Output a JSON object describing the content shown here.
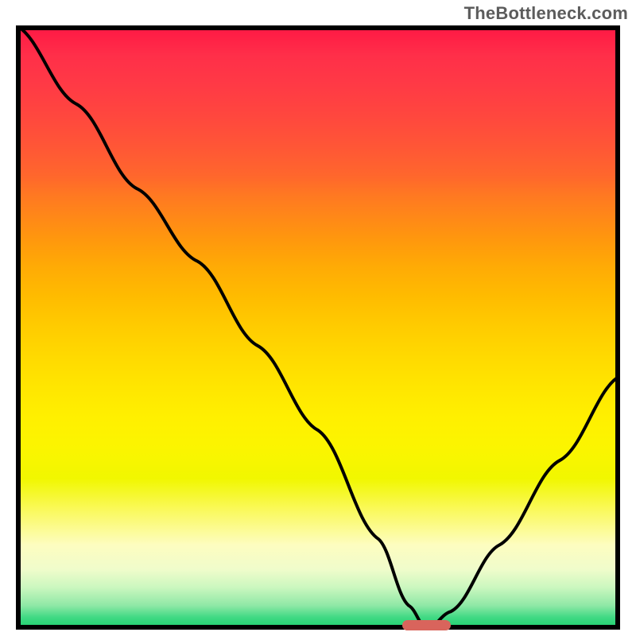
{
  "watermark": "TheBottleneck.com",
  "chart_data": {
    "type": "line",
    "title": "",
    "xlabel": "",
    "ylabel": "",
    "xlim": [
      0,
      100
    ],
    "ylim": [
      0,
      100
    ],
    "grid": false,
    "legend": false,
    "notes": "Bottleneck fit curve over a red→yellow→green vertical gradient. The minimum of the curve (near x≈68) is marked with a highlight bar.",
    "series": [
      {
        "name": "bottleneck_curve",
        "x": [
          0,
          10,
          20,
          30,
          40,
          50,
          60,
          65,
          68,
          72,
          80,
          90,
          100
        ],
        "y": [
          100,
          87,
          73,
          61,
          47,
          33,
          15,
          4,
          0,
          3,
          14,
          28,
          42
        ]
      }
    ],
    "minimum_marker": {
      "x": 68,
      "width_frac": 0.08
    },
    "gradient_stops": [
      {
        "pos": 0.0,
        "color": "#ff1744"
      },
      {
        "pos": 0.5,
        "color": "#ffcc00"
      },
      {
        "pos": 0.8,
        "color": "#faf959"
      },
      {
        "pos": 0.96,
        "color": "#8fe8a6"
      },
      {
        "pos": 1.0,
        "color": "#1bd06d"
      }
    ]
  }
}
